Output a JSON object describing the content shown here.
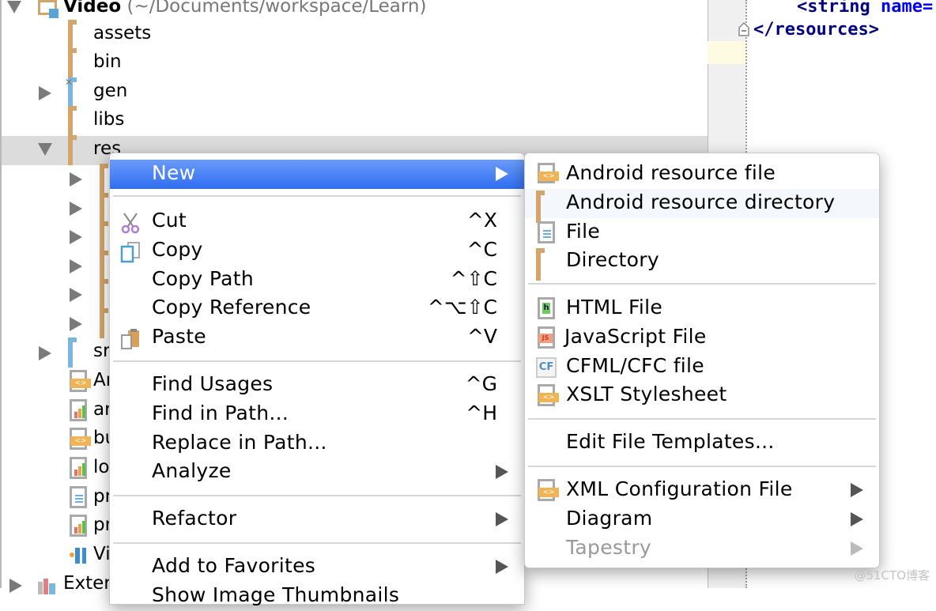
{
  "project_tree": {
    "root": {
      "name": "Video",
      "path": "(~/Documents/workspace/Learn)"
    },
    "items": [
      {
        "name": "assets",
        "icon": "folder-icon"
      },
      {
        "name": "bin",
        "icon": "folder-icon"
      },
      {
        "name": "gen",
        "icon": "generated-folder-icon"
      },
      {
        "name": "libs",
        "icon": "folder-icon"
      },
      {
        "name": "res",
        "icon": "folder-icon"
      },
      {
        "name": "sr",
        "icon": "source-folder-icon"
      },
      {
        "name": "Ar",
        "icon": "xml-file-icon"
      },
      {
        "name": "ar",
        "icon": "properties-file-icon"
      },
      {
        "name": "bu",
        "icon": "xml-file-icon"
      },
      {
        "name": "lo",
        "icon": "properties-file-icon"
      },
      {
        "name": "pr",
        "icon": "text-file-icon"
      },
      {
        "name": "pr",
        "icon": "properties-file-icon"
      },
      {
        "name": "Vi",
        "icon": "module-file-icon"
      },
      {
        "name": "Exter",
        "icon": "libraries-icon"
      }
    ]
  },
  "editor": {
    "lines": [
      {
        "tag": "<string",
        "attr": " name="
      },
      {
        "tag": "</resources>",
        "attr": ""
      }
    ]
  },
  "context_menu": {
    "items": [
      {
        "label": "New",
        "shortcut": "",
        "submenu": true
      },
      {
        "label": "Cut",
        "shortcut": "^X",
        "icon": "scissors-icon"
      },
      {
        "label": "Copy",
        "shortcut": "^C",
        "icon": "copy-icon"
      },
      {
        "label": "Copy Path",
        "shortcut": "^⇧C"
      },
      {
        "label": "Copy Reference",
        "shortcut": "^⌥⇧C"
      },
      {
        "label": "Paste",
        "shortcut": "^V",
        "icon": "paste-icon"
      },
      {
        "label": "Find Usages",
        "shortcut": "^G"
      },
      {
        "label": "Find in Path...",
        "shortcut": "^H"
      },
      {
        "label": "Replace in Path...",
        "shortcut": ""
      },
      {
        "label": "Analyze",
        "shortcut": "",
        "submenu": true
      },
      {
        "label": "Refactor",
        "shortcut": "",
        "submenu": true
      },
      {
        "label": "Add to Favorites",
        "shortcut": "",
        "submenu": true
      },
      {
        "label": "Show Image Thumbnails",
        "shortcut": ""
      }
    ]
  },
  "new_submenu": {
    "items": [
      {
        "label": "Android resource file",
        "icon": "android-resource-file-icon"
      },
      {
        "label": "Android resource directory",
        "icon": "folder-icon"
      },
      {
        "label": "File",
        "icon": "file-icon"
      },
      {
        "label": "Directory",
        "icon": "folder-icon"
      },
      {
        "label": "HTML File",
        "icon": "html-file-icon"
      },
      {
        "label": "JavaScript File",
        "icon": "javascript-file-icon"
      },
      {
        "label": "CFML/CFC file",
        "icon": "cfml-file-icon"
      },
      {
        "label": "XSLT Stylesheet",
        "icon": "xslt-file-icon"
      },
      {
        "label": "Edit File Templates...",
        "icon": ""
      },
      {
        "label": "XML Configuration File",
        "icon": "xml-config-file-icon",
        "submenu": true
      },
      {
        "label": "Diagram",
        "icon": "",
        "submenu": true
      },
      {
        "label": "Tapestry",
        "icon": "",
        "submenu": true,
        "disabled": true
      }
    ]
  },
  "watermark": "@51CTO博客"
}
